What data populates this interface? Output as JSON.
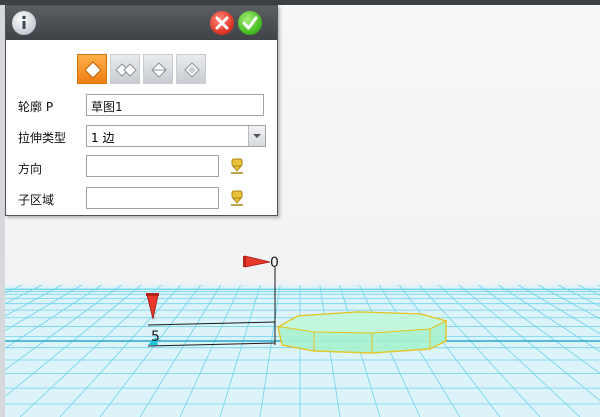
{
  "panel": {
    "header_icons": [
      "info-icon",
      "cancel-icon",
      "confirm-icon"
    ],
    "modes": [
      {
        "name": "extrude-one-side",
        "active": true
      },
      {
        "name": "extrude-two-sides",
        "active": false
      },
      {
        "name": "extrude-symmetric",
        "active": false
      },
      {
        "name": "extrude-both-directions",
        "active": false
      }
    ],
    "profile_label": "轮廓 P",
    "profile_value": "草图1",
    "extrude_type_label": "拉伸类型",
    "extrude_type_value": "1 边",
    "direction_label": "方向",
    "direction_value": "",
    "subregion_label": "子区域",
    "subregion_value": ""
  },
  "viewport": {
    "dimension_top": "0",
    "dimension_side": "5",
    "colors": {
      "grid_line": "#33c0e0",
      "grid_bg": "#dcf3fa",
      "solid_fill": "#8ff0c0",
      "solid_edge": "#e6c21a",
      "manip_arrow": "#e8392b",
      "dim_text": "#8a00a8"
    }
  }
}
